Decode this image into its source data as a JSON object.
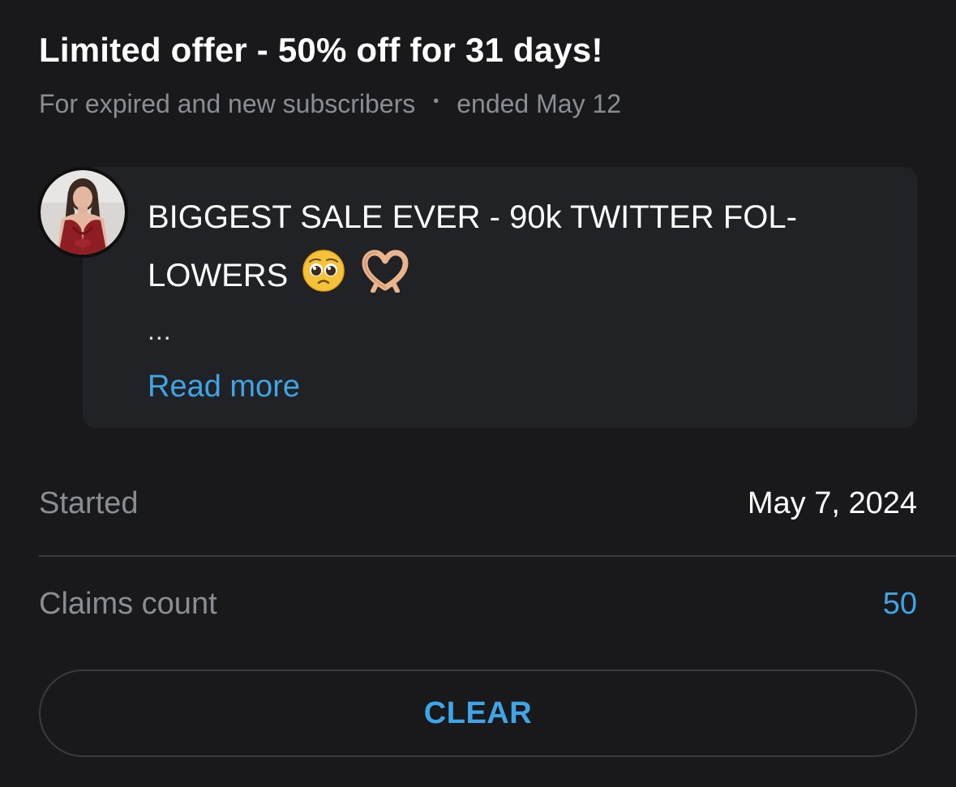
{
  "offer": {
    "title": "Limited offer - 50% off for 31 days!",
    "audience": "For expired and new subscribers",
    "separator": "•",
    "status": "ended May 12"
  },
  "message": {
    "line1": "BIGGEST SALE EVER - 90k TWITTER FOL-",
    "line2": "LOWERS",
    "emojis": [
      "pleading-face-emoji",
      "heart-hands-emoji"
    ],
    "ellipsis": "...",
    "read_more_label": "Read more",
    "avatar_icon": "profile-photo-avatar"
  },
  "details": {
    "started_label": "Started",
    "started_value": "May 7, 2024",
    "claims_label": "Claims count",
    "claims_value": "50"
  },
  "actions": {
    "clear_label": "CLEAR"
  },
  "colors": {
    "background": "#19191b",
    "card": "#212225",
    "accent": "#3fa5e6",
    "muted_text": "#8a8d93",
    "divider": "#3a3b3f"
  }
}
